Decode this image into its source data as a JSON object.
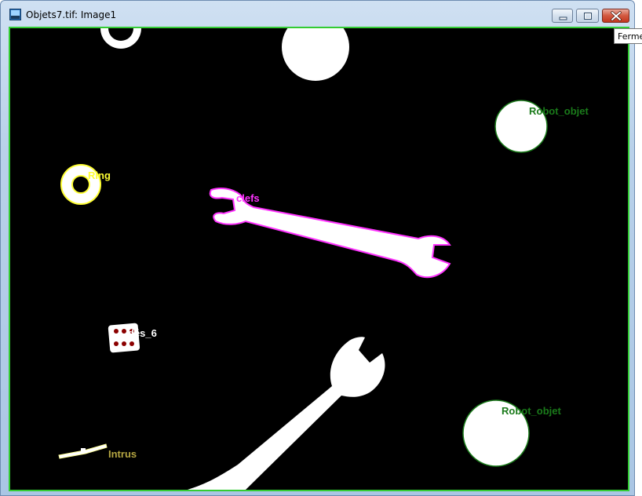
{
  "window": {
    "title": "Objets7.tif: Image1",
    "icons": {
      "app": "image-app-icon",
      "minimize": "minimize-icon",
      "maximize": "maximize-icon",
      "close": "close-icon"
    }
  },
  "tooltip": {
    "text": "Fermer"
  },
  "labels": {
    "robot_objet_top": "Robot_objet",
    "ring": "Ring",
    "clefs": "clefs",
    "des_6": "dés_6",
    "robot_objet_bottom": "Robot_objet",
    "intrus": "Intrus"
  },
  "colors": {
    "background": "#000000",
    "object_white": "#ffffff",
    "robot_label": "#1a7a1a",
    "ring_label": "#ffff33",
    "clefs_label": "#ff33ff",
    "des_label": "#ffffff",
    "intrus_label": "#b5a642",
    "frame": "#33cc33"
  }
}
